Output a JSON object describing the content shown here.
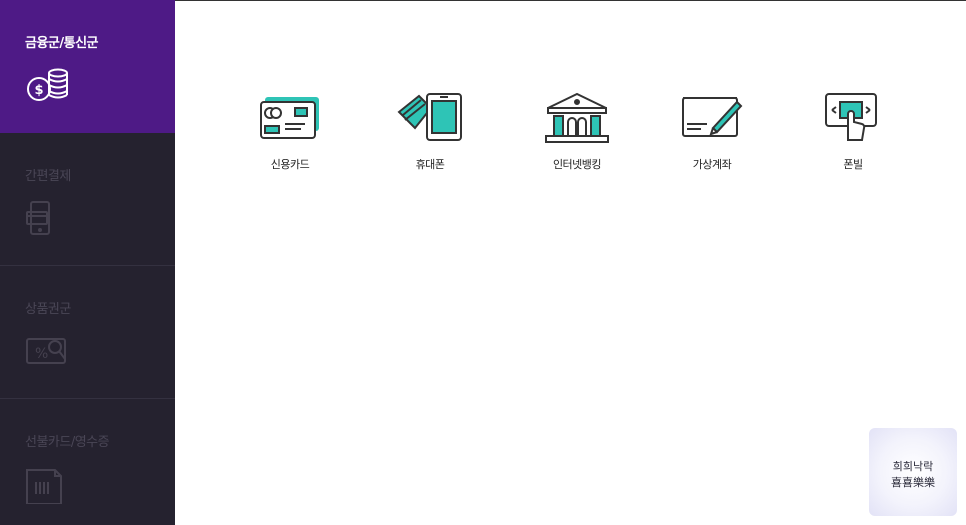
{
  "sidebar": {
    "items": [
      {
        "label": "금융군/통신군",
        "icon": "coins-icon",
        "active": true
      },
      {
        "label": "간편결제",
        "icon": "phone-card-icon",
        "active": false
      },
      {
        "label": "상품권군",
        "icon": "coupon-icon",
        "active": false
      },
      {
        "label": "선불카드/영수증",
        "icon": "receipt-icon",
        "active": false
      }
    ]
  },
  "main": {
    "menu": [
      {
        "label": "신용카드",
        "icon": "credit-card-icon"
      },
      {
        "label": "휴대폰",
        "icon": "mobile-phone-icon"
      },
      {
        "label": "인터넷뱅킹",
        "icon": "bank-icon"
      },
      {
        "label": "가상계좌",
        "icon": "virtual-account-icon"
      },
      {
        "label": "폰빌",
        "icon": "phonebill-icon"
      }
    ]
  },
  "stamp": {
    "line1": "희희낙락",
    "line2": "喜喜樂樂"
  },
  "colors": {
    "accent": "#4e1a86",
    "sidebar": "#25222f",
    "teal": "#2ec4b6",
    "ink": "#333333"
  }
}
